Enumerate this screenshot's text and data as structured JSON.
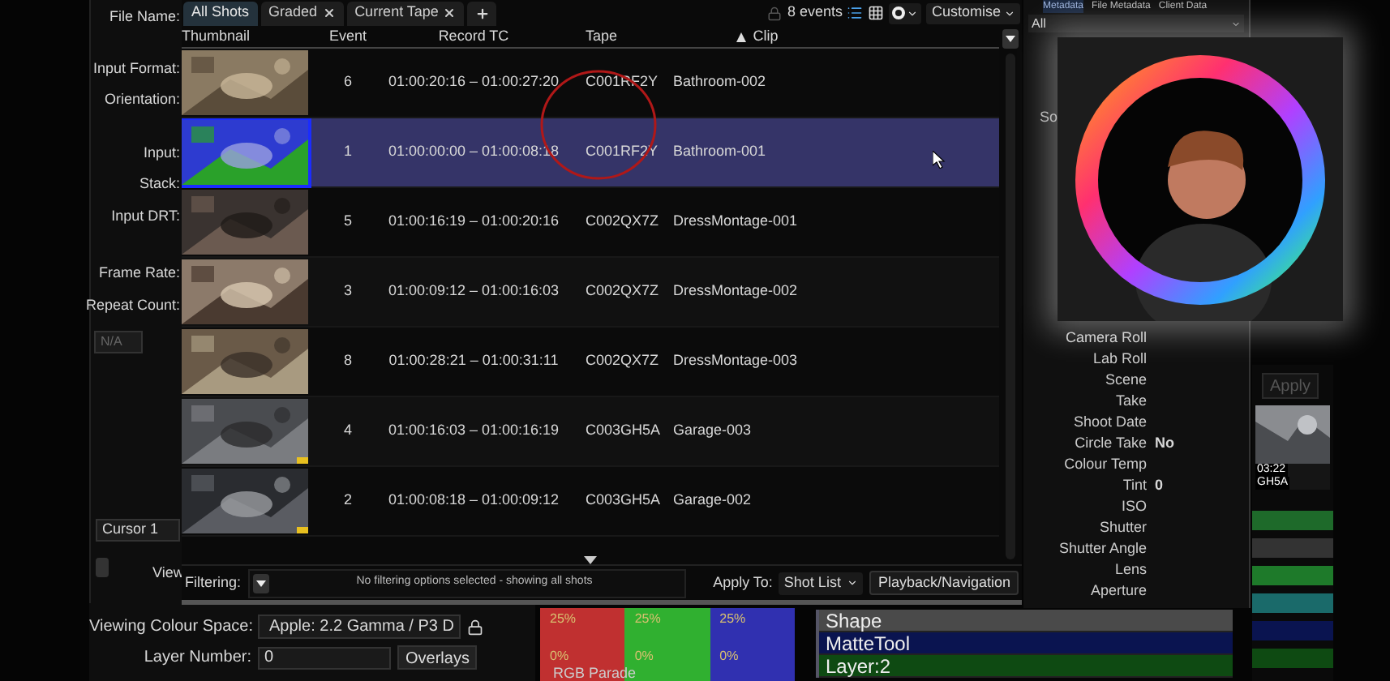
{
  "settings_panel": {
    "fields": [
      {
        "label": "File Name:"
      },
      {
        "label": "Input Format:"
      },
      {
        "label": "Orientation:"
      },
      {
        "label": "Input:"
      },
      {
        "label": "Stack:"
      },
      {
        "label": "Input DRT:"
      },
      {
        "label": "Frame Rate:"
      },
      {
        "label": "Repeat Count:"
      }
    ],
    "frame_dropdown": "N/A",
    "cursor": "Cursor 1",
    "view_label": "View",
    "viewing_colour_space": {
      "label": "Viewing Colour Space:",
      "value": "Apple: 2.2 Gamma / P3 D"
    },
    "layer_number": {
      "label": "Layer Number:",
      "value": "0"
    },
    "overlays_button": "Overlays"
  },
  "shot_list": {
    "tabs": [
      {
        "label": "All Shots",
        "selected": true,
        "closable": false
      },
      {
        "label": "Graded",
        "selected": false,
        "closable": true
      },
      {
        "label": "Current Tape",
        "selected": false,
        "closable": true
      }
    ],
    "event_count": "8 events",
    "views": [
      {
        "kind": "list",
        "selected": true
      },
      {
        "kind": "grid",
        "selected": false
      }
    ],
    "customise": "Customise",
    "columns": [
      {
        "label": "Thumbnail",
        "sorted": false
      },
      {
        "label": "Event",
        "sorted": false
      },
      {
        "label": "Record TC",
        "sorted": false
      },
      {
        "label": "Tape",
        "sorted": false
      },
      {
        "label": "Clip",
        "sorted": true
      }
    ],
    "rows": [
      {
        "event": "6",
        "record_tc": "01:00:20:16 – 01:00:27:20",
        "tape": "C001RF2Y",
        "clip": "Bathroom-002",
        "selected": false,
        "flagged": false
      },
      {
        "event": "1",
        "record_tc": "01:00:00:00 – 01:00:08:18",
        "tape": "C001RF2Y",
        "clip": "Bathroom-001",
        "selected": true,
        "flagged": false
      },
      {
        "event": "5",
        "record_tc": "01:00:16:19 – 01:00:20:16",
        "tape": "C002QX7Z",
        "clip": "DressMontage-001",
        "selected": false,
        "flagged": false
      },
      {
        "event": "3",
        "record_tc": "01:00:09:12 – 01:00:16:03",
        "tape": "C002QX7Z",
        "clip": "DressMontage-002",
        "selected": false,
        "flagged": false
      },
      {
        "event": "8",
        "record_tc": "01:00:28:21 – 01:00:31:11",
        "tape": "C002QX7Z",
        "clip": "DressMontage-003",
        "selected": false,
        "flagged": false
      },
      {
        "event": "4",
        "record_tc": "01:00:16:03 – 01:00:16:19",
        "tape": "C003GH5A",
        "clip": "Garage-003",
        "selected": false,
        "flagged": true
      },
      {
        "event": "2",
        "record_tc": "01:00:08:18 – 01:00:09:12",
        "tape": "C003GH5A",
        "clip": "Garage-002",
        "selected": false,
        "flagged": true
      }
    ],
    "filtering": {
      "label": "Filtering:",
      "status": "No filtering options selected - showing all shots"
    },
    "apply_to": {
      "label": "Apply To:",
      "value": "Shot List"
    },
    "playback_button": "Playback/Navigation"
  },
  "metadata_panel": {
    "tabs": [
      {
        "label": "Metadata",
        "selected": true
      },
      {
        "label": "File Metadata",
        "selected": false
      },
      {
        "label": "Client Data",
        "selected": false
      }
    ],
    "filter": "All",
    "partial_label": "So",
    "fields": [
      {
        "label": "Camera Roll"
      },
      {
        "label": "Lab Roll"
      },
      {
        "label": "Scene"
      },
      {
        "label": "Take"
      },
      {
        "label": "Shoot Date"
      },
      {
        "label": "Circle Take",
        "value": "No"
      },
      {
        "label": "Colour Temp"
      },
      {
        "label": "Tint",
        "value": "0"
      },
      {
        "label": "ISO"
      },
      {
        "label": "Shutter"
      },
      {
        "label": "Shutter Angle"
      },
      {
        "label": "Lens"
      },
      {
        "label": "Aperture"
      }
    ]
  },
  "side_panel": {
    "apply_button": "Apply",
    "thumbnail_caption": [
      "03:22",
      "GH5A"
    ]
  },
  "scope": {
    "top_labels": [
      "25%",
      "25%",
      "25%"
    ],
    "bottom_labels": [
      "0%",
      "0%",
      "0%"
    ],
    "title": "RGB Parade"
  },
  "layers": [
    {
      "name": "Shape",
      "color": "#4a4a4a"
    },
    {
      "name": "MatteTool",
      "color": "#0a1450"
    },
    {
      "name": "Layer:2",
      "color": "#0e4a12"
    }
  ]
}
